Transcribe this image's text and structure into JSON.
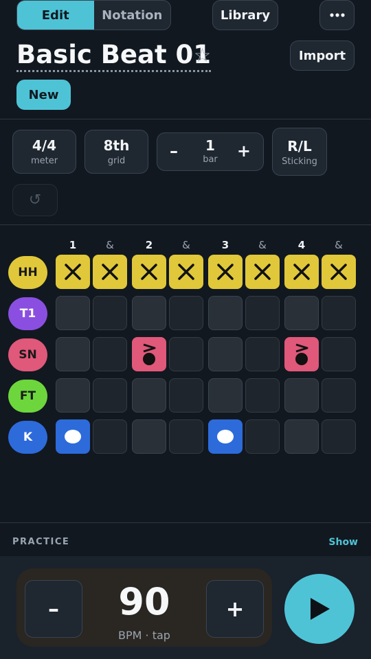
{
  "tabs": [
    {
      "label": "Edit",
      "active": true
    },
    {
      "label": "Notation",
      "active": false
    }
  ],
  "header": {
    "library_label": "Library",
    "more_icon": "more-horizontal-icon",
    "title": "Basic Beat 01",
    "star_icon": "star-outline-icon",
    "import_label": "Import",
    "new_label": "New"
  },
  "options": {
    "meter": {
      "value": "4/4",
      "label": "meter"
    },
    "grid": {
      "value": "8th",
      "label": "grid"
    },
    "bars": {
      "value": "1",
      "label": "bar",
      "minus": "–",
      "plus": "+"
    },
    "sticking": {
      "value": "R/L",
      "label": "Sticking"
    },
    "undo_icon": "undo-icon"
  },
  "counts": [
    "1",
    "&",
    "2",
    "&",
    "3",
    "&",
    "4",
    "&"
  ],
  "lanes": [
    {
      "label": "HH",
      "color": "#e0c83a",
      "text_color": "#1a1a1a",
      "pattern": [
        1,
        1,
        1,
        1,
        1,
        1,
        1,
        1
      ],
      "mark": "x"
    },
    {
      "label": "T1",
      "color": "#8a4fe0",
      "text_color": "#ffffff",
      "pattern": [
        0,
        0,
        0,
        0,
        0,
        0,
        0,
        0
      ],
      "mark": "dot"
    },
    {
      "label": "SN",
      "color": "#e0587a",
      "text_color": "#1a1a1a",
      "pattern": [
        0,
        0,
        1,
        0,
        0,
        0,
        1,
        0
      ],
      "mark": "accent-dot"
    },
    {
      "label": "FT",
      "color": "#6dd63c",
      "text_color": "#1a1a1a",
      "pattern": [
        0,
        0,
        0,
        0,
        0,
        0,
        0,
        0
      ],
      "mark": "dot"
    },
    {
      "label": "K",
      "color": "#2d6bdb",
      "text_color": "#ffffff",
      "pattern": [
        1,
        0,
        0,
        0,
        1,
        0,
        0,
        0
      ],
      "mark": "dot"
    }
  ],
  "practice": {
    "label": "PRACTICE",
    "toggle_label": "Show"
  },
  "tempo": {
    "minus": "–",
    "plus": "+",
    "bpm": "90",
    "label": "BPM · tap",
    "play_icon": "play-icon"
  },
  "colors": {
    "accent": "#4fc3d6",
    "background": "#121820"
  }
}
